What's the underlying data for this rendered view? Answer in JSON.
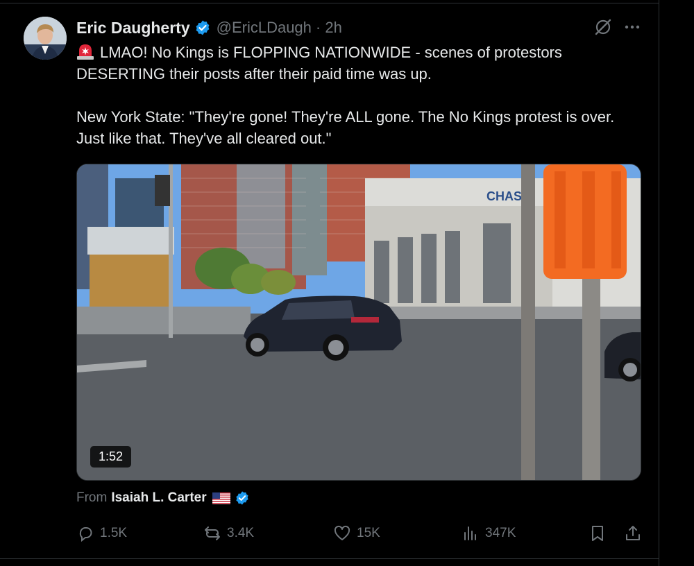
{
  "tweet": {
    "author_name": "Eric Daugherty",
    "author_handle": "@EricLDaugh",
    "time": "· 2h",
    "text_line1": "LMAO! No Kings is FLOPPING NATIONWIDE - scenes of protestors DESERTING their posts after their paid time was up.",
    "text_line2": "New York State: \"They're gone! They're ALL gone. The No Kings protest is over. Just like that. They've all cleared out.\""
  },
  "media": {
    "duration": "1:52",
    "signage": "CHASE",
    "from_label": "From",
    "from_author": "Isaiah L. Carter"
  },
  "actions": {
    "replies": "1.5K",
    "reposts": "3.4K",
    "likes": "15K",
    "views": "347K"
  },
  "colors": {
    "background": "#000000",
    "text": "#e7e9ea",
    "muted": "#71767b",
    "verified": "#1d9bf0",
    "divider": "#2f3336"
  },
  "icons": [
    "siren-emoji",
    "verified-badge-icon",
    "grok-icon",
    "more-icon",
    "us-flag-emoji",
    "reply-icon",
    "repost-icon",
    "like-icon",
    "views-icon",
    "bookmark-icon",
    "share-icon"
  ]
}
